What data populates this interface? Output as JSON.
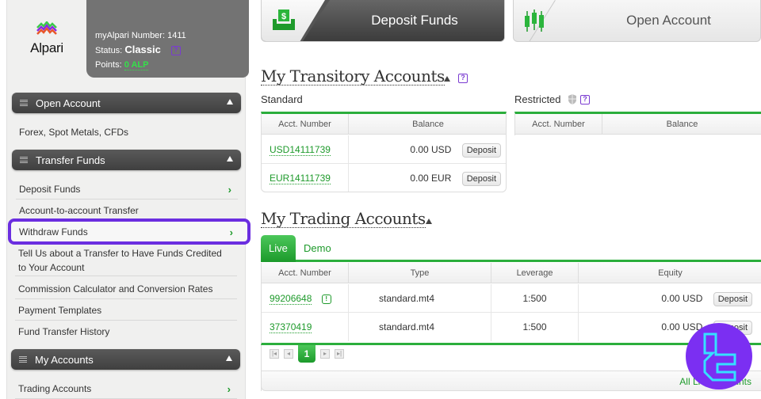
{
  "logo": {
    "text": "Alpari"
  },
  "profile": {
    "number_label": "myAlpari Number:",
    "number_value": "1411",
    "status_label": "Status:",
    "status_value": "Classic",
    "points_label": "Points:",
    "points_value": "0 ALP"
  },
  "sidebar": {
    "sections": [
      {
        "title": "Open Account",
        "items": [
          {
            "label": "Forex, Spot Metals, CFDs"
          }
        ]
      },
      {
        "title": "Transfer Funds",
        "items": [
          {
            "label": "Deposit Funds"
          },
          {
            "label": "Account-to-account Transfer"
          },
          {
            "label": "Withdraw Funds"
          },
          {
            "label": "Tell Us about a Transfer to Have Funds Credited"
          },
          {
            "label": "to Your Account"
          },
          {
            "label": "Commission Calculator and Conversion Rates"
          },
          {
            "label": "Payment Templates"
          },
          {
            "label": "Fund Transfer History"
          }
        ]
      },
      {
        "title": "My Accounts",
        "items": [
          {
            "label": "Trading Accounts"
          }
        ]
      }
    ]
  },
  "top_buttons": {
    "deposit": "Deposit Funds",
    "open_account": "Open Account"
  },
  "transitory": {
    "title": "My Transitory Accounts",
    "standard_label": "Standard",
    "restricted_label": "Restricted",
    "columns": [
      "Acct. Number",
      "Balance"
    ],
    "rows": [
      {
        "acct": "USD14111739",
        "balance": "0.00 USD",
        "action": "Deposit"
      },
      {
        "acct": "EUR14111739",
        "balance": "0.00 EUR",
        "action": "Deposit"
      }
    ]
  },
  "trading": {
    "title": "My Trading Accounts",
    "tabs": [
      "Live",
      "Demo"
    ],
    "active_tab": "Live",
    "columns": [
      "Acct. Number",
      "Type",
      "Leverage",
      "Equity"
    ],
    "rows": [
      {
        "acct": "99206648",
        "badge": "!",
        "type": "standard.mt4",
        "leverage": "1:500",
        "equity": "0.00 USD",
        "action": "Deposit"
      },
      {
        "acct": "37370419",
        "type": "standard.mt4",
        "leverage": "1:500",
        "equity": "0.00 USD",
        "action": "Deposit"
      }
    ],
    "current_page": "1",
    "footer_link": "All Live Accounts"
  },
  "colors": {
    "accent_green": "#1e9a2b",
    "highlight_purple": "#6b2ee0",
    "help_purple": "#7a3bd1"
  }
}
